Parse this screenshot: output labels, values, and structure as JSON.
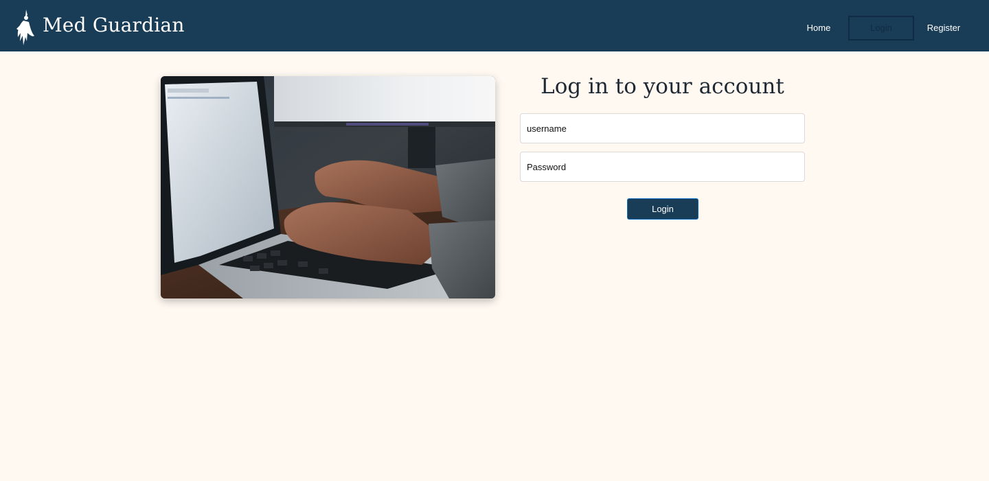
{
  "brand": {
    "name": "Med Guardian",
    "logo_icon": "winged-figure-logo-icon"
  },
  "nav": {
    "home": "Home",
    "login": "Login",
    "register": "Register"
  },
  "hero": {
    "image": "laptop-typing-photo"
  },
  "form": {
    "title": "Log in to your account",
    "username_placeholder": "username",
    "username_value": "",
    "password_placeholder": "Password",
    "password_value": "",
    "submit_label": "Login"
  },
  "colors": {
    "navbar": "#1a3d57",
    "background": "#fff9f2",
    "button": "#1a3d57",
    "active_nav_border": "#0f2a44"
  }
}
